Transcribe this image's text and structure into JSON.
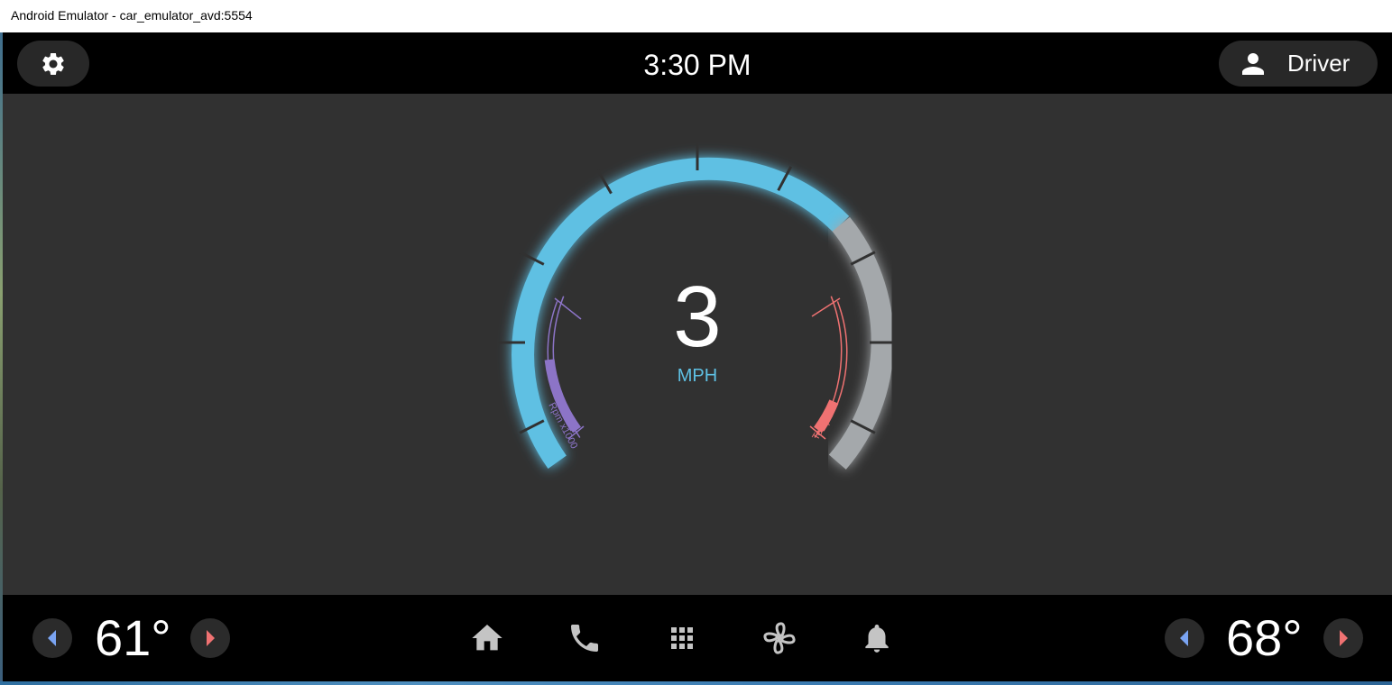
{
  "window": {
    "title": "Android Emulator - car_emulator_avd:5554"
  },
  "status_bar": {
    "settings_icon": "gear-icon",
    "time": "3:30 PM",
    "user": {
      "icon": "person-icon",
      "label": "Driver"
    }
  },
  "dashboard": {
    "speed": "3",
    "speed_unit": "MPH",
    "rpm_label": "Rpm x1000",
    "temp_label": "Temp F",
    "rpm_level": 0.42,
    "temp_level": 0.18,
    "colors": {
      "speed_arc": "#5ec0e3",
      "speed_arc_inactive": "#a4a8ab",
      "rpm": "#8c74c7",
      "temp": "#f07272",
      "background": "#313131"
    }
  },
  "bottom_bar": {
    "left_temp": "61°",
    "right_temp": "68°",
    "icons": [
      "home-icon",
      "phone-icon",
      "app-grid-icon",
      "fan-icon",
      "bell-icon"
    ],
    "colors": {
      "decrease_arrow": "#7aa4f2",
      "increase_arrow": "#f07272"
    }
  }
}
